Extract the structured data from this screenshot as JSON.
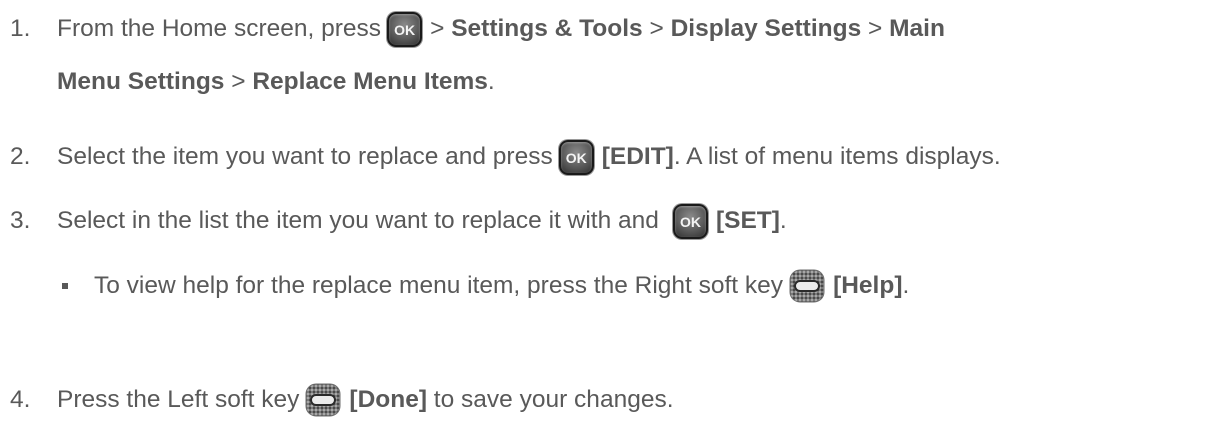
{
  "steps": [
    {
      "number": "1.",
      "part1": "From the Home screen, press",
      "sep1": ">",
      "b1": "Settings & Tools",
      "sep2": ">",
      "b2": "Display Settings",
      "sep3": ">",
      "b3a": "Main",
      "b3b": "Menu Settings",
      "sep4": ">",
      "b4": "Replace Menu Items",
      "end": "."
    },
    {
      "number": "2.",
      "part1": "Select the item you want to replace and press",
      "b1": "[EDIT]",
      "part2": ". A list of menu items displays."
    },
    {
      "number": "3.",
      "part1": "Select in the list the item you want to replace it with and",
      "b1": "[SET]",
      "part2": "."
    },
    {
      "number": "4.",
      "part1": "Press the Left soft key",
      "b1": "[Done]",
      "part2": "to save your changes."
    }
  ],
  "sub_bullet": {
    "part1": "To view help for the replace menu item, press the Right soft key",
    "b1": "[Help]",
    "part2": "."
  },
  "keys": {
    "ok_label": "OK"
  }
}
